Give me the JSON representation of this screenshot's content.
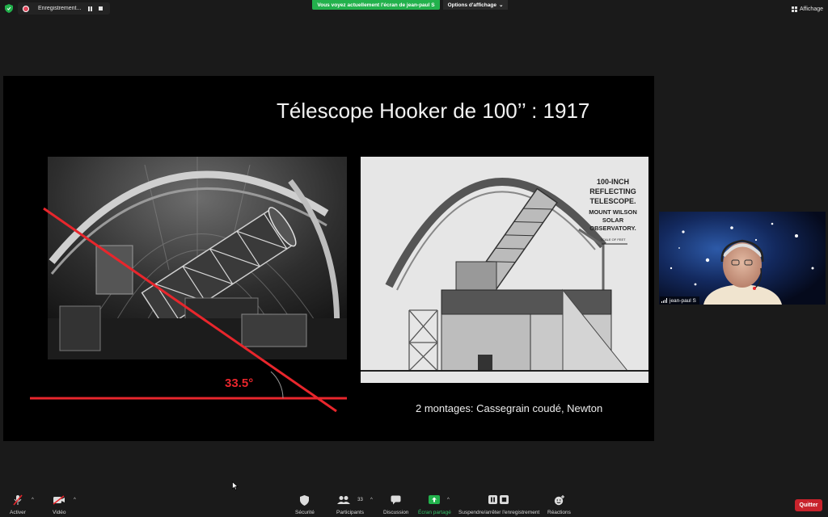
{
  "topbar": {
    "recording_label": "Enregistrement...",
    "share_banner": "Vous voyez actuellement l'écran de jean-paul S",
    "view_options": "Options d'affichage",
    "view_button": "Affichage"
  },
  "slide": {
    "title": "Télescope Hooker de 100’’ : 1917",
    "angle_label": "33.5°",
    "caption": "2 montages: Cassegrain coudé, Newton",
    "diagram_text": [
      "100-INCH",
      "REFLECTING",
      "TELESCOPE.",
      "MOUNT WILSON",
      "SOLAR",
      "OBSERVATORY."
    ],
    "scale_text": "SCALE OF FEET"
  },
  "video": {
    "participant_name": "jean-paul S"
  },
  "toolbar": {
    "mute": "Activer",
    "video": "Vidéo",
    "security": "Sécurité",
    "participants": "Participants",
    "participants_count": "33",
    "chat": "Discussion",
    "share": "Écran partagé",
    "record": "Suspendre/arrêter l'enregistrement",
    "reactions": "Réactions",
    "quit": "Quitter"
  },
  "colors": {
    "share_green": "#22b14c",
    "quit_red": "#c8232c",
    "annotation_red": "#e8262c"
  }
}
